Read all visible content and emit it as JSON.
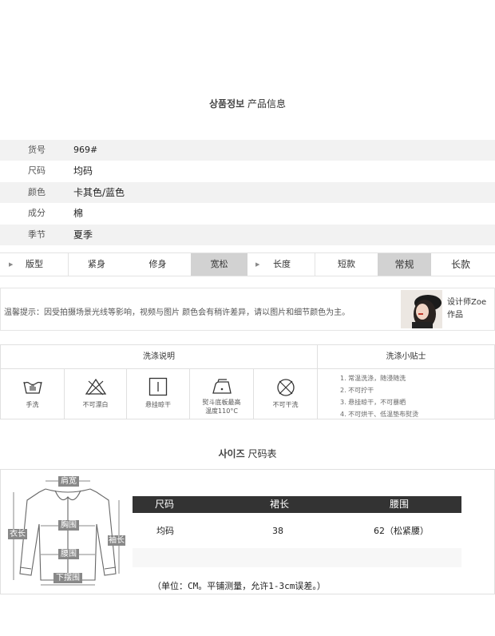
{
  "product_info": {
    "title_ko": "상품정보",
    "title_zh": "产品信息",
    "rows": [
      {
        "label": "货号",
        "value": "969#"
      },
      {
        "label": "尺码",
        "value": "均码"
      },
      {
        "label": "颜色",
        "value": "卡其色/蓝色"
      },
      {
        "label": "成分",
        "value": "棉"
      },
      {
        "label": "季节",
        "value": "夏季"
      }
    ]
  },
  "fit": {
    "silhouette_label": "版型",
    "silhouette_options": [
      "紧身",
      "修身",
      "宽松"
    ],
    "silhouette_selected": "宽松",
    "length_label": "长度",
    "length_options": [
      "短款",
      "常规",
      "长款"
    ],
    "length_selected": "常规"
  },
  "notice": {
    "text": "温馨提示：因受拍摄场景光线等影响，视频与图片  颜色会有稍许差异，请以图片和细节颜色为主。",
    "designer_line1": "设计师Zoe",
    "designer_line2": "作品"
  },
  "wash": {
    "instructions_title": "洗涤说明",
    "tips_title": "洗涤小贴士",
    "symbols": [
      {
        "icon": "hand-wash-icon",
        "label": "手洗"
      },
      {
        "icon": "no-bleach-icon",
        "label": "不可漂白"
      },
      {
        "icon": "hang-dry-icon",
        "label": "悬挂晾干"
      },
      {
        "icon": "iron-icon",
        "label": "熨斗底板最高",
        "label2": "温度110°C"
      },
      {
        "icon": "no-tumble-dry-icon",
        "label": "不可干洗"
      }
    ],
    "tips": [
      "1. 常温洗涤，随浸随洗",
      "2. 不可拧干",
      "3. 悬挂晾干，不可暴晒",
      "4. 不可烘干、低温垫布熨烫"
    ]
  },
  "size": {
    "title_ko": "사이즈",
    "title_zh": "尺码表",
    "diagram_labels": {
      "shoulder": "肩宽",
      "chest": "胸围",
      "waist": "腰围",
      "hem": "下摆围",
      "length": "衣长",
      "sleeve": "袖长"
    },
    "table": {
      "headers": [
        "尺码",
        "裙长",
        "腰围"
      ],
      "rows": [
        [
          "均码",
          "38",
          "62（松紧腰）"
        ]
      ]
    },
    "note": "（单位：CM。平铺测量，允许1-3cm误差。）"
  }
}
